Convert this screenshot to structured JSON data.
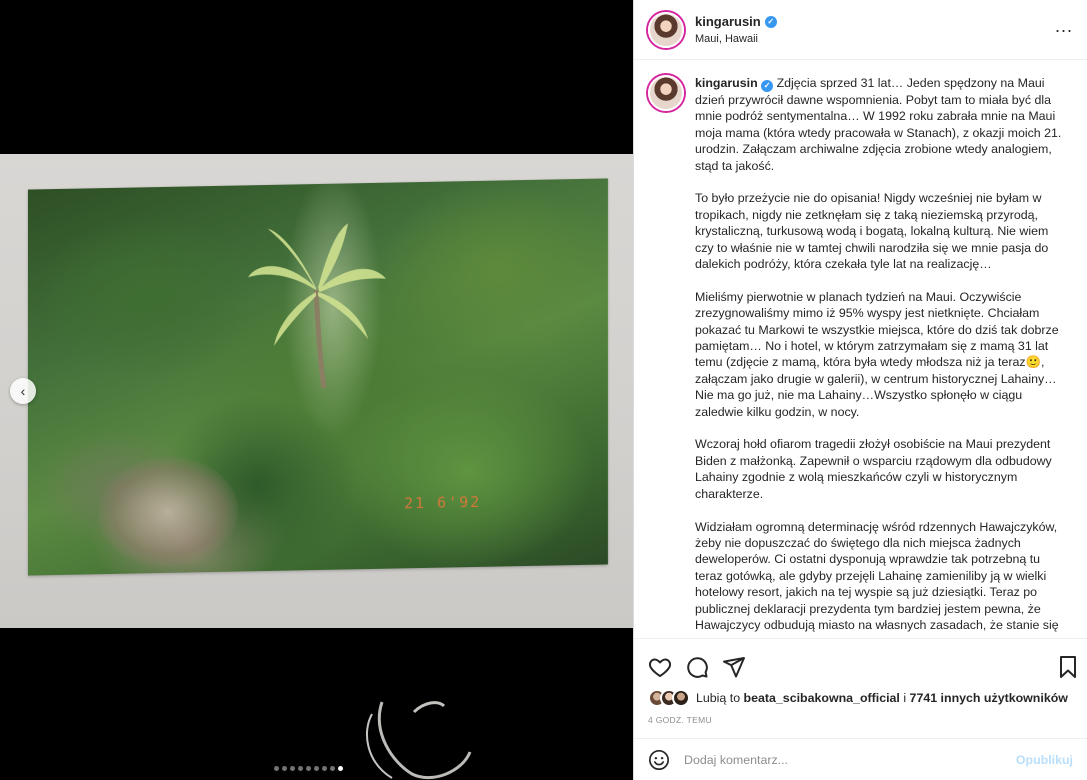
{
  "post": {
    "username": "kingarusin",
    "location": "Maui, Hawaii",
    "verified": true,
    "more_label": "...",
    "photo_date_stamp": "21  6'92",
    "carousel": {
      "total": 9,
      "active": 9,
      "prev_glyph": "‹"
    }
  },
  "caption": {
    "username": "kingarusin",
    "paragraphs": [
      "Zdjęcia sprzed 31 lat… Jeden spędzony na Maui dzień przywrócił dawne wspomnienia. Pobyt tam to miała być dla mnie podróż sentymentalna… W 1992 roku zabrała mnie na Maui moja mama (która wtedy pracowała w Stanach), z okazji moich 21. urodzin. Załączam archiwalne zdjęcia zrobione wtedy analogiem, stąd ta jakość.",
      "To było przeżycie nie do opisania! Nigdy wcześniej nie byłam w tropikach, nigdy nie zetknęłam się z taką nieziemską przyrodą, krystaliczną, turkusową wodą i bogatą, lokalną kulturą. Nie wiem czy to właśnie nie w tamtej chwili narodziła się we mnie pasja do dalekich podróży, która czekała tyle lat na realizację…",
      "Mieliśmy pierwotnie w planach tydzień na Maui. Oczywiście zrezygnowaliśmy mimo iż 95% wyspy jest nietknięte. Chciałam pokazać tu Markowi te wszystkie miejsca, które do dziś tak dobrze pamiętam… No i hotel, w którym zatrzymałam się z mamą 31 lat temu (zdjęcie z mamą, która była wtedy młodsza niż ja teraz🙂, załączam jako drugie w galerii), w centrum historycznej Lahainy… Nie ma go już, nie ma Lahainy…Wszystko spłonęło w ciągu zaledwie kilku godzin, w nocy.",
      "Wczoraj hołd ofiarom tragedii złożył osobiście na Maui prezydent Biden z małżonką. Zapewnił o wsparciu rządowym dla odbudowy Lahainy zgodnie z wolą mieszkańców czyli w historycznym charakterze.",
      "Widziałam ogromną determinację wśród rdzennych Hawajczyków, żeby nie dopuszczać do świętego dla nich miejsca żadnych deweloperów. Ci ostatni dysponują wprawdzie tak potrzebną tu teraz gotówką, ale gdyby przejęli Lahainę zamieniliby ją w wielki hotelowy resort, jakich na tej wyspie są już dziesiątki. Teraz po publicznej deklaracji prezydenta tym bardziej jestem pewna, że Hawajczycy odbudują miasto na własnych zasadach, że stanie się"
    ]
  },
  "actions": {
    "like_icon": "heart-icon",
    "comment_icon": "comment-icon",
    "share_icon": "paper-plane-icon",
    "save_icon": "bookmark-icon"
  },
  "likes": {
    "prefix": "Lubią to",
    "first_user": "beata_scibakowna_official",
    "middle": "i",
    "others": "7741 innych użytkowników"
  },
  "timestamp": "4 GODZ. TEMU",
  "comment": {
    "placeholder": "Dodaj komentarz...",
    "post_label": "Opublikuj",
    "emoji_icon": "smiley-icon"
  },
  "colors": {
    "accent_blue": "#3897f0",
    "post_button_disabled": "#b9dffc",
    "story_ring": "#d6249f",
    "muted_text": "#8e8e8e"
  }
}
